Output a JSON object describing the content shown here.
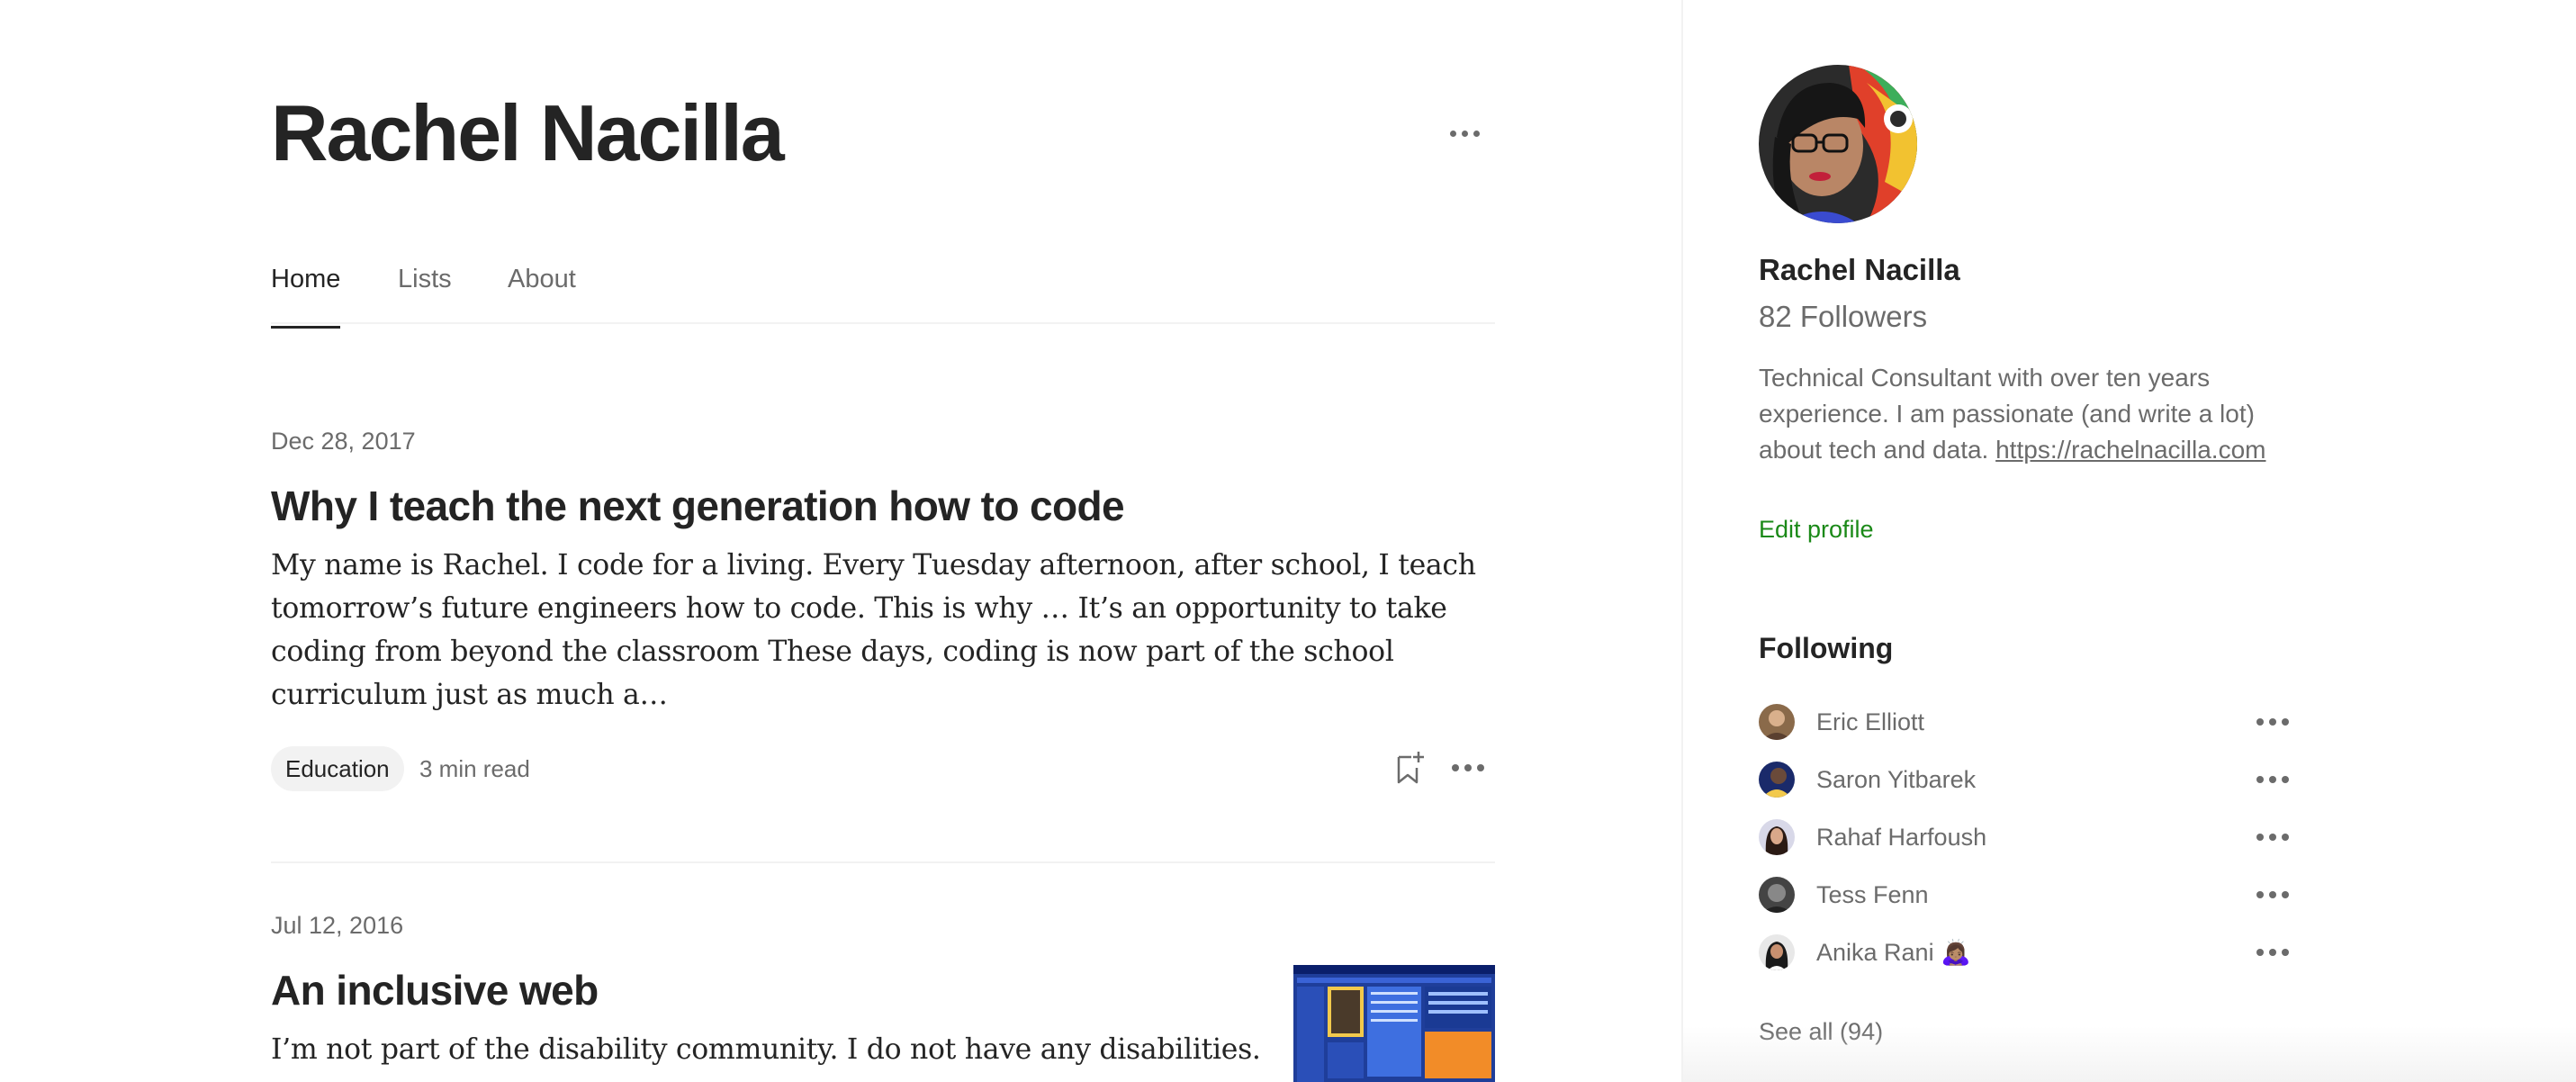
{
  "profile": {
    "name": "Rachel Nacilla",
    "followers": "82 Followers",
    "bio_text": "Technical Consultant with over ten years experience. I am passionate (and write a lot) about tech and data.",
    "bio_link": "https://rachelnacilla.com",
    "edit_profile": "Edit profile"
  },
  "tabs": [
    {
      "label": "Home",
      "active": true
    },
    {
      "label": "Lists",
      "active": false
    },
    {
      "label": "About",
      "active": false
    }
  ],
  "posts": [
    {
      "date": "Dec 28, 2017",
      "title": "Why I teach the next generation how to code",
      "excerpt": "My name is Rachel. I code for a living. Every Tuesday afternoon, after school, I teach tomorrow’s future engineers how to code. This is why … It’s an opportunity to take coding from beyond the classroom These days, coding is now part of the school curriculum just as much a…",
      "tag": "Education",
      "read_time": "3 min read"
    },
    {
      "date": "Jul 12, 2016",
      "title": "An inclusive web",
      "excerpt": "I’m not part of the disability community. I do not have any disabilities."
    }
  ],
  "following": {
    "title": "Following",
    "people": [
      {
        "name": "Eric Elliott"
      },
      {
        "name": "Saron Yitbarek"
      },
      {
        "name": "Rahaf Harfoush"
      },
      {
        "name": "Tess Fenn"
      },
      {
        "name": "Anika Rani 🙇🏽‍♀️"
      }
    ],
    "see_all": "See all (94)"
  },
  "colors": {
    "text": "#242424",
    "muted": "#6b6b6b",
    "edit_green": "#1a8917",
    "tag_bg": "#f2f2f2"
  },
  "icons": [
    "more-horizontal-icon",
    "bookmark-add-icon"
  ]
}
